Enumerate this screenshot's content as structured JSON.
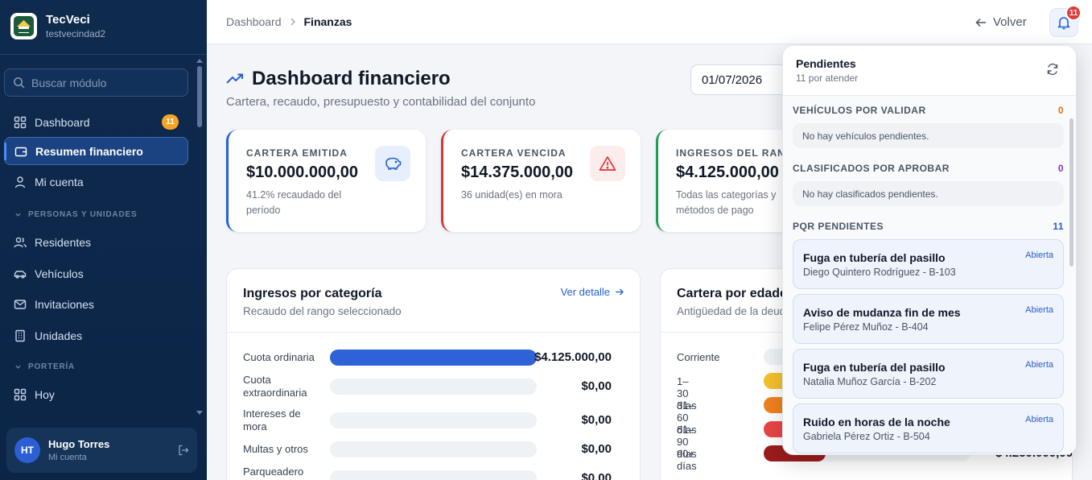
{
  "sidebar": {
    "brand_name": "TecVeci",
    "brand_sub": "testvecindad2",
    "logo_text": "TEST VECINDAD",
    "search_placeholder": "Buscar módulo",
    "items": [
      {
        "label": "Dashboard",
        "icon": "grid-icon",
        "badge": "11"
      },
      {
        "label": "Resumen financiero",
        "icon": "wallet-icon",
        "active": true
      },
      {
        "label": "Mi cuenta",
        "icon": "user-icon"
      },
      {
        "label": "Residentes",
        "icon": "users-icon"
      },
      {
        "label": "Vehículos",
        "icon": "car-icon"
      },
      {
        "label": "Invitaciones",
        "icon": "mail-icon"
      },
      {
        "label": "Unidades",
        "icon": "building-icon"
      },
      {
        "label": "Hoy",
        "icon": "grid-icon"
      }
    ],
    "sections": [
      "PERSONAS Y UNIDADES",
      "PORTERÍA"
    ],
    "user": {
      "initials": "HT",
      "name": "Hugo Torres",
      "sub": "Mi cuenta"
    }
  },
  "topbar": {
    "breadcrumb": [
      "Dashboard",
      "Finanzas"
    ],
    "back_label": "Volver",
    "bell_badge": "11"
  },
  "header": {
    "title": "Dashboard financiero",
    "subtitle": "Cartera, recaudo, presupuesto y contabilidad del conjunto",
    "date_value": "01/07/2026"
  },
  "kpis": [
    {
      "label": "CARTERA EMITIDA",
      "value": "$10.000.000,00",
      "note": "41.2% recaudado del período",
      "accent": "#2460d6",
      "icon": "piggy-bank-icon"
    },
    {
      "label": "CARTERA VENCIDA",
      "value": "$14.375.000,00",
      "note": "36 unidad(es) en mora",
      "accent": "#d93636",
      "icon": "warning-icon"
    },
    {
      "label": "INGRESOS DEL RANGO",
      "value": "$4.125.000,00",
      "note": "Todas las categorías y métodos de pago",
      "accent": "#1f9d55",
      "icon": "trend-icon"
    }
  ],
  "income_card": {
    "title": "Ingresos por categoría",
    "subtitle": "Recaudo del rango seleccionado",
    "link": "Ver detalle",
    "rows": [
      {
        "label": "Cuota ordinaria",
        "value": "$4.125.000,00",
        "fraction": 1.0
      },
      {
        "label": "Cuota extraordinaria",
        "value": "$0,00",
        "fraction": 0
      },
      {
        "label": "Intereses de mora",
        "value": "$0,00",
        "fraction": 0
      },
      {
        "label": "Multas y otros",
        "value": "$0,00",
        "fraction": 0
      },
      {
        "label": "Parqueadero",
        "value": "$0,00",
        "fraction": 0
      }
    ]
  },
  "aging_card": {
    "title": "Cartera por edades",
    "subtitle": "Antigüedad de la deuda",
    "rows": [
      {
        "label": "Corriente",
        "color": "#eef1f5",
        "fraction": 0
      },
      {
        "label": "1–30 días",
        "color": "#f4c02c",
        "fraction": 0.3
      },
      {
        "label": "31–60 días",
        "color": "#f0811e",
        "fraction": 0.3
      },
      {
        "label": "61–90 días",
        "color": "#e84545",
        "fraction": 0.3
      },
      {
        "label": "90+ días",
        "color": "#9b1c1c",
        "fraction": 0.3,
        "value": "$4.250.000,00"
      }
    ]
  },
  "pending": {
    "title": "Pendientes",
    "subtitle": "11 por atender",
    "sections": [
      {
        "title": "VEHÍCULOS POR VALIDAR",
        "count": "0",
        "count_color": "#d97706",
        "empty": "No hay vehículos pendientes."
      },
      {
        "title": "CLASIFICADOS POR APROBAR",
        "count": "0",
        "count_color": "#8b2fc9",
        "empty": "No hay clasificados pendientes."
      },
      {
        "title": "PQR PENDIENTES",
        "count": "11",
        "count_color": "#2460d6"
      }
    ],
    "pqr": [
      {
        "title": "Fuga en tubería del pasillo",
        "sub": "Diego Quintero Rodríguez - B-103",
        "status": "Abierta"
      },
      {
        "title": "Aviso de mudanza fin de mes",
        "sub": "Felipe Pérez Muñoz - B-404",
        "status": "Abierta"
      },
      {
        "title": "Fuga en tubería del pasillo",
        "sub": "Natalia Muñoz García - B-202",
        "status": "Abierta"
      },
      {
        "title": "Ruido en horas de la noche",
        "sub": "Gabriela Pérez Ortiz - B-504",
        "status": "Abierta"
      }
    ]
  }
}
